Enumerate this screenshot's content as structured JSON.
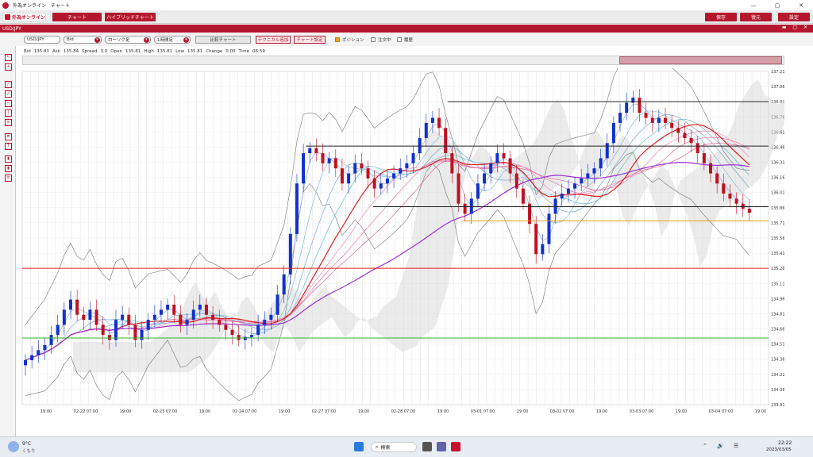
{
  "window": {
    "title": "外為オンライン　チャート",
    "min": "—",
    "max": "▢",
    "close": "✕"
  },
  "menu": {
    "brand": "外為オンライン",
    "chart": "チャート",
    "hybrid": "ハイブリッドチャート",
    "save": "保存",
    "restore": "復元",
    "settings": "設定"
  },
  "symbol": {
    "pair": "USD/JPY",
    "controls": "▬ □ ✕"
  },
  "toolbar": {
    "pair_select": "USD/JPY",
    "price_type": "Bid",
    "chart_type": "ローソク足",
    "timeframe": "1時間足",
    "compare": "比較チャート",
    "add_tech": "テクニカル追加",
    "chart_settings": "チャート設定",
    "position": "ポジション",
    "ordering": "注文中",
    "history": "履歴",
    "position_on": true,
    "ordering_on": false,
    "history_on": false
  },
  "quote": {
    "bid_l": "Bid",
    "bid": "135.81",
    "ask_l": "Ask",
    "ask": "135.84",
    "spread_l": "Spread",
    "spread": "3.0",
    "open_l": "Open",
    "open": "135.81",
    "high_l": "High",
    "high": "135.81",
    "low_l": "Low",
    "low": "135.81",
    "change_l": "Change",
    "change": "0.00",
    "time_l": "Time",
    "time": "06:59"
  },
  "chart_data": {
    "type": "candlestick",
    "ylim": [
      133.91,
      137.21
    ],
    "yticks": [
      "137.21",
      "137.06",
      "136.91",
      "136.76",
      "136.61",
      "136.46",
      "136.31",
      "136.16",
      "136.01",
      "135.86",
      "135.71",
      "135.56",
      "135.41",
      "135.26",
      "135.11",
      "134.96",
      "134.81",
      "134.66",
      "134.51",
      "134.36",
      "134.21",
      "134.06",
      "133.91"
    ],
    "xticks": [
      "19:00",
      "02-22 07:00",
      "19:00",
      "02-23 07:00",
      "19:00",
      "02-24 07:00",
      "19:00",
      "02-27 07:00",
      "19:00",
      "02-28 07:00",
      "19:00",
      "03-01 07:00",
      "19:00",
      "03-02 07:00",
      "19:00",
      "03-03 07:00",
      "19:00",
      "03-04 07:00",
      "19:00"
    ],
    "hlines": [
      {
        "value": 136.91,
        "color": "#222",
        "from": 0.57
      },
      {
        "value": 136.47,
        "color": "#222",
        "from": 0.38
      },
      {
        "value": 135.87,
        "color": "#222",
        "from": 0.47
      },
      {
        "value": 135.73,
        "color": "#e0a020",
        "from": 0.59
      },
      {
        "value": 135.26,
        "color": "#e02020",
        "from": 0.0
      },
      {
        "value": 134.57,
        "color": "#30b030",
        "from": 0.0
      }
    ],
    "close_path": [
      134.35,
      134.4,
      134.45,
      134.5,
      134.6,
      134.7,
      134.85,
      134.95,
      134.8,
      134.75,
      134.85,
      134.7,
      134.6,
      134.55,
      134.75,
      134.8,
      134.7,
      134.55,
      134.65,
      134.75,
      134.8,
      134.85,
      134.9,
      134.8,
      134.7,
      134.75,
      134.85,
      134.9,
      134.8,
      134.75,
      134.7,
      134.65,
      134.6,
      134.55,
      134.58,
      134.6,
      134.7,
      134.75,
      134.8,
      135.0,
      135.2,
      135.6,
      136.1,
      136.4,
      136.45,
      136.4,
      136.3,
      136.35,
      136.25,
      136.1,
      136.2,
      136.3,
      136.25,
      136.15,
      136.05,
      136.1,
      136.15,
      136.2,
      136.25,
      136.3,
      136.4,
      136.55,
      136.7,
      136.75,
      136.65,
      136.4,
      136.2,
      135.9,
      135.8,
      135.95,
      136.1,
      136.2,
      136.3,
      136.4,
      136.35,
      136.2,
      136.05,
      135.9,
      135.7,
      135.4,
      135.5,
      135.8,
      135.95,
      136.0,
      136.05,
      136.1,
      136.15,
      136.2,
      136.25,
      136.35,
      136.5,
      136.7,
      136.8,
      136.9,
      136.95,
      136.8,
      136.75,
      136.7,
      136.75,
      136.7,
      136.65,
      136.6,
      136.55,
      136.5,
      136.4,
      136.3,
      136.2,
      136.1,
      136.0,
      135.95,
      135.9,
      135.85,
      135.81
    ]
  },
  "taskbar": {
    "weather_temp": "9°C",
    "weather_desc": "くもり",
    "search": "検索",
    "time": "22:22",
    "date": "2023/03/05"
  }
}
